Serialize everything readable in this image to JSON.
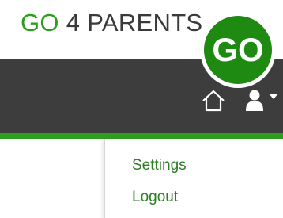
{
  "brand": {
    "prefix": "GO",
    "suffix": " 4 PARENTS"
  },
  "logo": {
    "text": "GO"
  },
  "navbar": {
    "icons": {
      "home": "home-icon",
      "user": "user-icon",
      "caret": "caret-down-icon"
    }
  },
  "user_menu": {
    "items": [
      {
        "label": "Settings"
      },
      {
        "label": "Logout"
      }
    ]
  },
  "colors": {
    "accent": "#2e9e1f",
    "navbar": "#3d3d3d",
    "logo_green": "#1f8a12",
    "text_dark": "#3a3a3a",
    "menu_text": "#2e7d25"
  }
}
